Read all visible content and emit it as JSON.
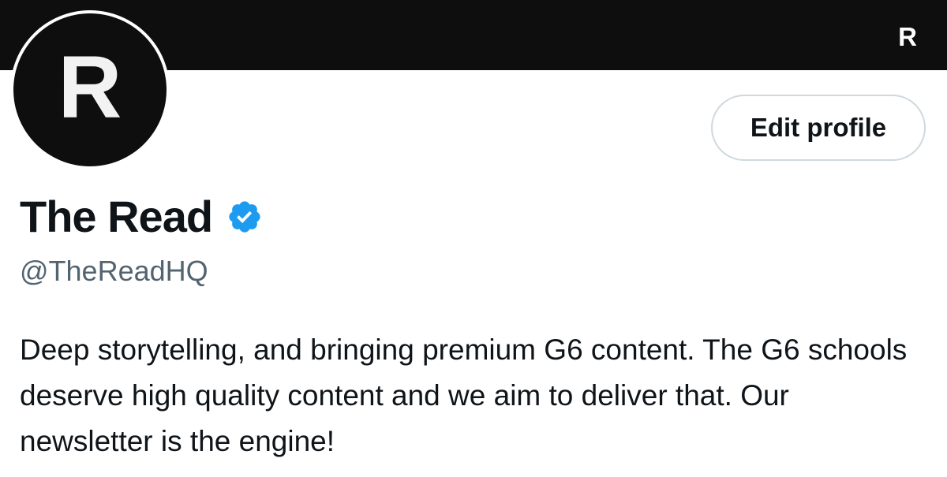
{
  "banner": {
    "mark": "R",
    "background_color": "#0e0e0e"
  },
  "avatar": {
    "letter": "R",
    "background_color": "#0e0e0e"
  },
  "profile": {
    "display_name": "The Read",
    "verified_icon": "verified-badge-icon",
    "verified_color": "#1d9bf0",
    "handle": "@TheReadHQ",
    "bio": "Deep storytelling, and bringing premium G6 content. The G6 schools deserve high quality content and we aim to deliver that. Our newsletter is the engine!"
  },
  "actions": {
    "edit_profile_label": "Edit profile"
  }
}
